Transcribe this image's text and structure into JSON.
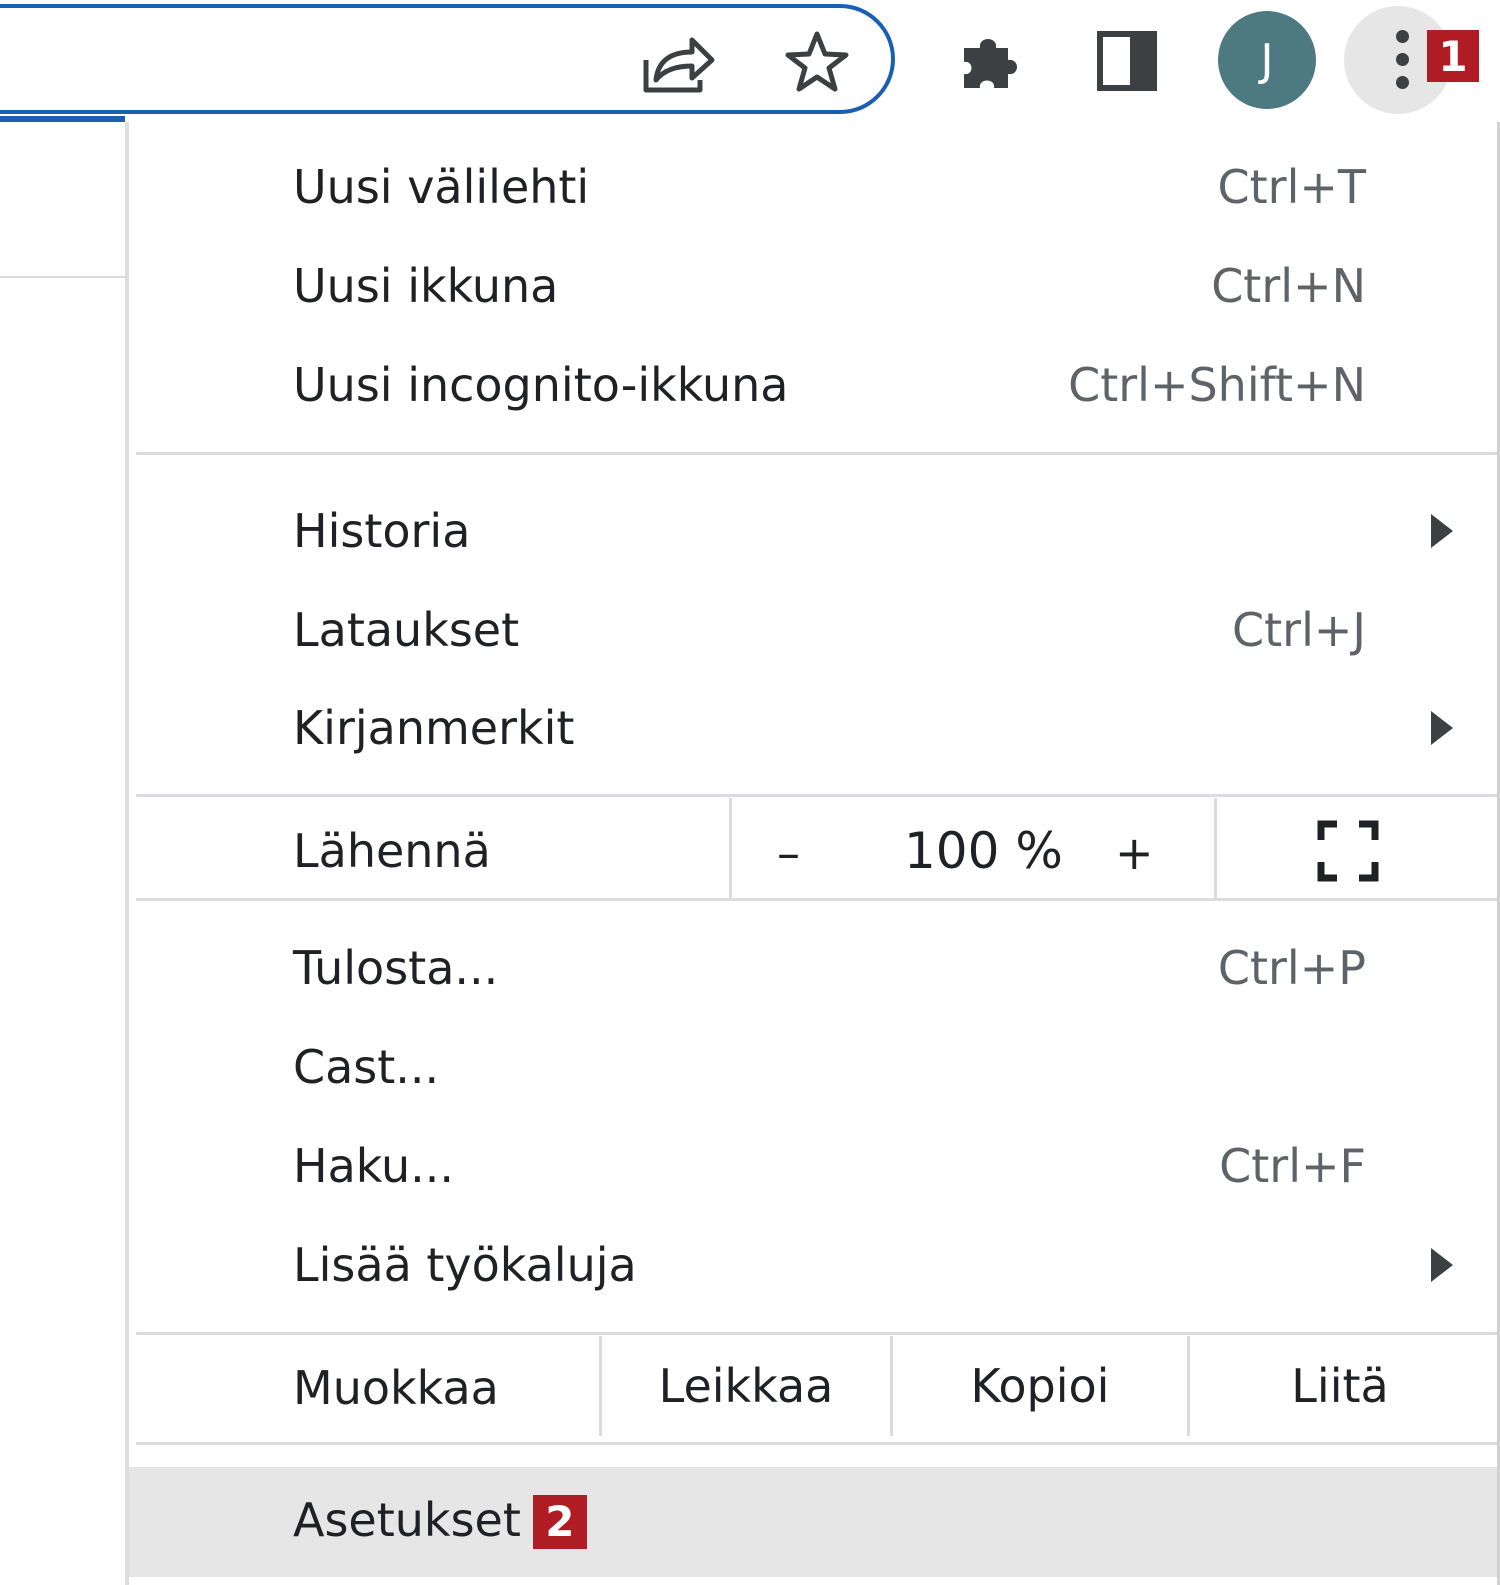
{
  "toolbar": {
    "avatar_initial": "J",
    "badge_menu": "1",
    "icons": [
      "share-icon",
      "star-icon",
      "extensions-icon",
      "side-panel-icon",
      "avatar",
      "more-vert-icon"
    ],
    "avatar_color": "#4d7a80",
    "badge_color": "#b01c24",
    "focus_ring_color": "#1a5fb4"
  },
  "menu": {
    "group1": [
      {
        "label": "Uusi välilehti",
        "shortcut": "Ctrl+T"
      },
      {
        "label": "Uusi ikkuna",
        "shortcut": "Ctrl+N"
      },
      {
        "label": "Uusi incognito-ikkuna",
        "shortcut": "Ctrl+Shift+N"
      }
    ],
    "group2": [
      {
        "label": "Historia",
        "shortcut": "",
        "submenu": true
      },
      {
        "label": "Lataukset",
        "shortcut": "Ctrl+J"
      },
      {
        "label": "Kirjanmerkit",
        "shortcut": "",
        "submenu": true
      }
    ],
    "zoom": {
      "label": "Lähennä",
      "minus": "–",
      "value": "100 %",
      "plus": "+"
    },
    "group3": [
      {
        "label": "Tulosta...",
        "shortcut": "Ctrl+P"
      },
      {
        "label": "Cast...",
        "shortcut": ""
      },
      {
        "label": "Haku...",
        "shortcut": "Ctrl+F"
      },
      {
        "label": "Lisää työkaluja",
        "shortcut": "",
        "submenu": true
      }
    ],
    "edit": {
      "label": "Muokkaa",
      "cut": "Leikkaa",
      "copy": "Kopioi",
      "paste": "Liitä"
    },
    "settings": {
      "label": "Asetukset",
      "badge": "2"
    }
  }
}
